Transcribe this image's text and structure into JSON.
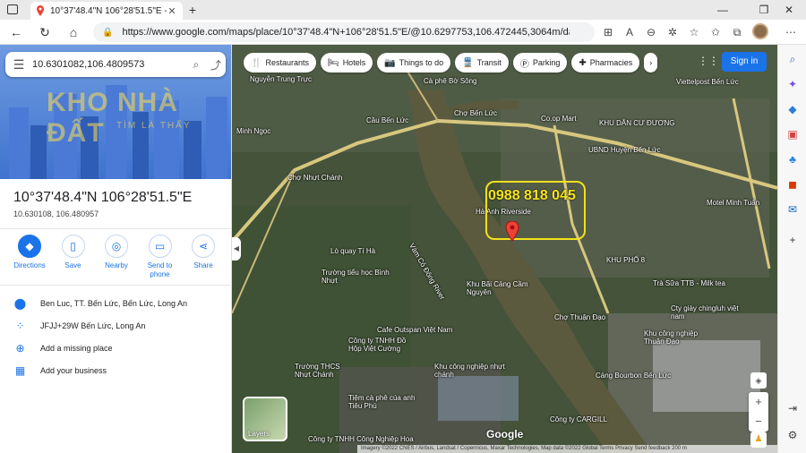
{
  "browser": {
    "tab_title": "10°37'48.4\"N 106°28'51.5\"E - Go",
    "url": "https://www.google.com/maps/place/10°37'48.4\"N+106°28'51.5\"E/@10.6297753,106.472445,3064m/data=!3m1!1e3!4..."
  },
  "search": {
    "value": "10.6301082,106.4809573"
  },
  "watermark": {
    "main": "KHO NHÀ ĐẤT",
    "sub": "TÌM LÀ THẤY"
  },
  "place": {
    "title": "10°37'48.4\"N 106°28'51.5\"E",
    "coords": "10.630108, 106.480957"
  },
  "actions": [
    {
      "label": "Directions"
    },
    {
      "label": "Save"
    },
    {
      "label": "Nearby"
    },
    {
      "label": "Send to phone"
    },
    {
      "label": "Share"
    }
  ],
  "info": [
    {
      "text": "Ben Luc, TT. Bến Lức, Bến Lức, Long An"
    },
    {
      "text": "JFJJ+29W Bến Lức, Long An"
    },
    {
      "text": "Add a missing place"
    },
    {
      "text": "Add your business"
    }
  ],
  "chips": [
    {
      "label": "Restaurants"
    },
    {
      "label": "Hotels"
    },
    {
      "label": "Things to do"
    },
    {
      "label": "Transit"
    },
    {
      "label": "Parking"
    },
    {
      "label": "Pharmacies"
    }
  ],
  "map": {
    "signin": "Sign in",
    "phone": "0988 818 045",
    "layers": "Layers",
    "logo": "Google",
    "attribution": "Imagery ©2022 CNES / Airbus, Landsat / Copernicus, Maxar Technologies, Map data ©2022   Global   Terms   Privacy   Send feedback   200 m",
    "labels": [
      "Nguyễn Trung Trực",
      "Cà phê Bờ Sông",
      "Chợ Bến Lức",
      "Co.op Mart",
      "Cầu Bến Lức",
      "KHU DÂN CƯ ĐƯƠNG",
      "UBND Huyện Bến Lức",
      "Viettelpost Bến Lức",
      "Minh Ngọc",
      "Chợ Nhựt Chánh",
      "Hà Anh Riverside",
      "Motel Minh Tuấn",
      "KHU PHỐ 8",
      "Vàm Cỏ Đông River",
      "Lò quay Tí Hà",
      "Trường tiểu học Bình Nhựt",
      "Khu Bãi Cảng Cầm Nguyên",
      "Trà Sữa TTB - Milk tea",
      "Chợ Thuận Đạo",
      "Cty giày chingluh việt nam",
      "Cafe Outspan Việt Nam",
      "Công ty TNHH Đồ Hộp Việt Cường",
      "Khu công nghiệp Thuận Đạo",
      "Cảng Bourbon Bến Lức",
      "Trường THCS Nhựt Chánh",
      "Tiệm cà phê cúa anh Tiêu Phú",
      "Khu công nghiệp nhựt chánh",
      "Công ty CARGILL",
      "Công ty TNHH Công Nghiệp Hoa"
    ]
  },
  "colors": {
    "accent": "#1a73e8",
    "phone_highlight": "#f2e01b",
    "hero_bg": "#4a7ad6"
  }
}
